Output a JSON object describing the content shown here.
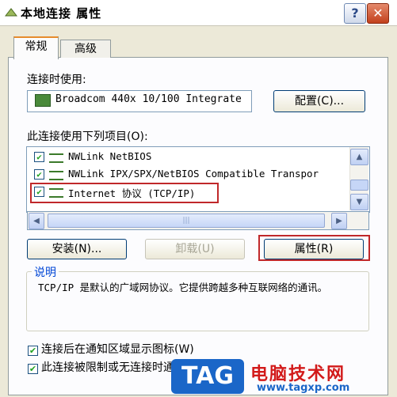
{
  "window": {
    "title": "本地连接 属性",
    "help": "?",
    "close": "✕"
  },
  "tabs": [
    {
      "label": "常规"
    },
    {
      "label": "高级"
    }
  ],
  "connect_using": {
    "label": "连接时使用:",
    "adapter": "Broadcom 440x 10/100 Integrate",
    "config_button": "配置(C)..."
  },
  "items": {
    "label": "此连接使用下列项目(O):",
    "rows": [
      {
        "text": "NWLink NetBIOS",
        "checked": true
      },
      {
        "text": "NWLink IPX/SPX/NetBIOS Compatible Transpor",
        "checked": true
      },
      {
        "text": "Internet 协议 (TCP/IP)",
        "checked": true
      }
    ],
    "hscroll_grip": "|||"
  },
  "buttons": {
    "install": "安装(N)...",
    "uninstall": "卸载(U)",
    "properties": "属性(R)"
  },
  "description": {
    "label": "说明",
    "text": "TCP/IP 是默认的广域网协议。它提供跨越多种互联网络的通讯。"
  },
  "options": [
    {
      "label": "连接后在通知区域显示图标(W)",
      "checked": true
    },
    {
      "label": "此连接被限制或无连接时通知我(M)",
      "checked": true
    }
  ],
  "watermark": {
    "tag": "TAG",
    "title": "电脑技术网",
    "url": "www.tagxp.com"
  }
}
